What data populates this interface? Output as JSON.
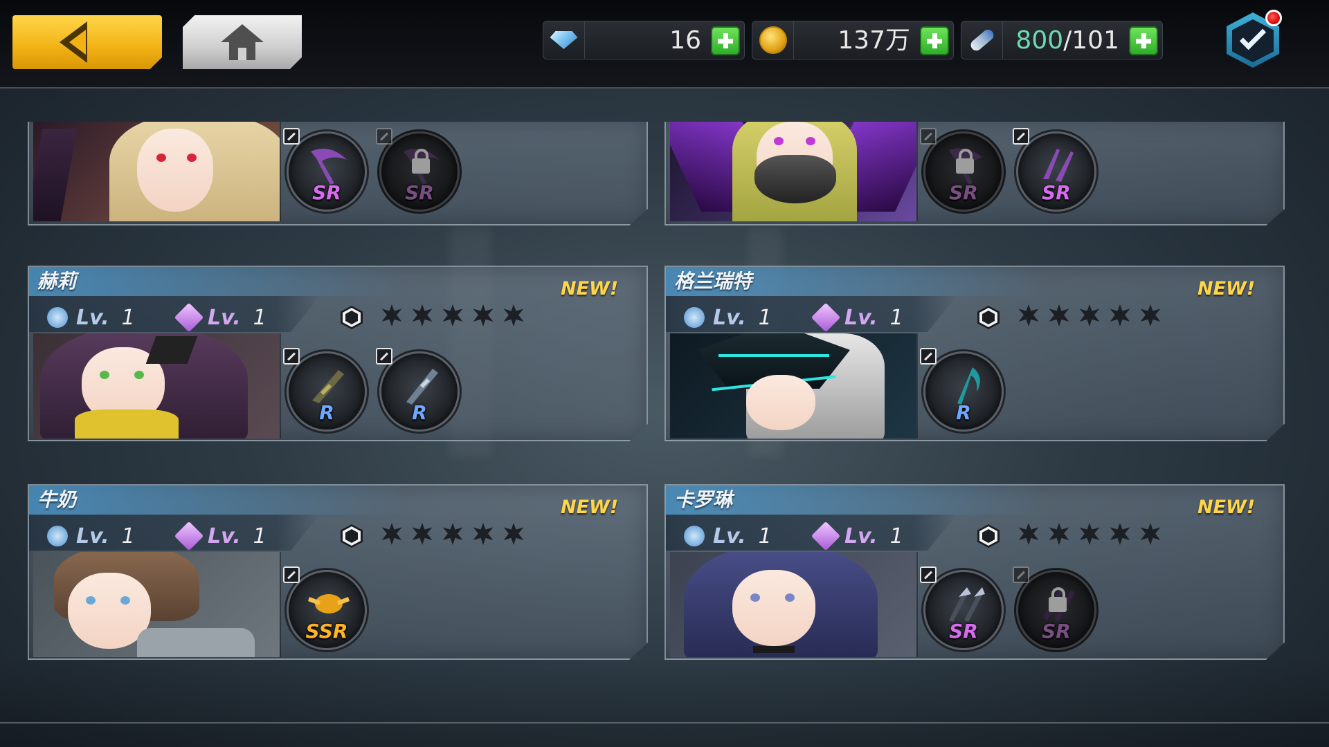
{
  "topbar": {
    "back_icon": "chevron-left-icon",
    "home_icon": "home-icon",
    "resources": {
      "diamond": {
        "icon": "diamond-icon",
        "value": "16"
      },
      "gold": {
        "icon": "gold-coin-icon",
        "value": "137万"
      },
      "energy": {
        "icon": "energy-potion-icon",
        "current": "800",
        "separator": "/",
        "max": "101"
      }
    },
    "mail": {
      "icon": "mail-check-icon",
      "has_notification": true
    }
  },
  "colors": {
    "back_button": "#f2b214",
    "new_badge": "#ffd54a",
    "rarity_r": "#6fa8ff",
    "rarity_sr": "#d86bf0",
    "rarity_ssr": "#ffb326",
    "energy_current": "#6ddab0",
    "plus_button": "#2fae2b"
  },
  "characters": [
    {
      "name": "",
      "new": "",
      "level": "",
      "weapon_level": "",
      "weapons": [
        {
          "rarity": "SR",
          "locked": false
        },
        {
          "rarity": "SR",
          "locked": true
        }
      ]
    },
    {
      "name": "",
      "new": "",
      "level": "",
      "weapon_level": "",
      "weapons": [
        {
          "rarity": "SR",
          "locked": true
        },
        {
          "rarity": "SR",
          "locked": false
        }
      ]
    },
    {
      "name": "赫莉",
      "new": "NEW!",
      "lv_label": "Lv.",
      "level": "1",
      "weapon_level": "1",
      "stars": 0,
      "weapons": [
        {
          "rarity": "R",
          "locked": false
        },
        {
          "rarity": "R",
          "locked": false
        }
      ]
    },
    {
      "name": "格兰瑞特",
      "new": "NEW!",
      "lv_label": "Lv.",
      "level": "1",
      "weapon_level": "1",
      "stars": 0,
      "weapons": [
        {
          "rarity": "R",
          "locked": false
        }
      ]
    },
    {
      "name": "牛奶",
      "new": "NEW!",
      "lv_label": "Lv.",
      "level": "1",
      "weapon_level": "1",
      "stars": 0,
      "weapons": [
        {
          "rarity": "SSR",
          "locked": false
        }
      ]
    },
    {
      "name": "卡罗琳",
      "new": "NEW!",
      "lv_label": "Lv.",
      "level": "1",
      "weapon_level": "1",
      "stars": 0,
      "weapons": [
        {
          "rarity": "SR",
          "locked": false
        },
        {
          "rarity": "SR",
          "locked": true
        }
      ]
    }
  ]
}
